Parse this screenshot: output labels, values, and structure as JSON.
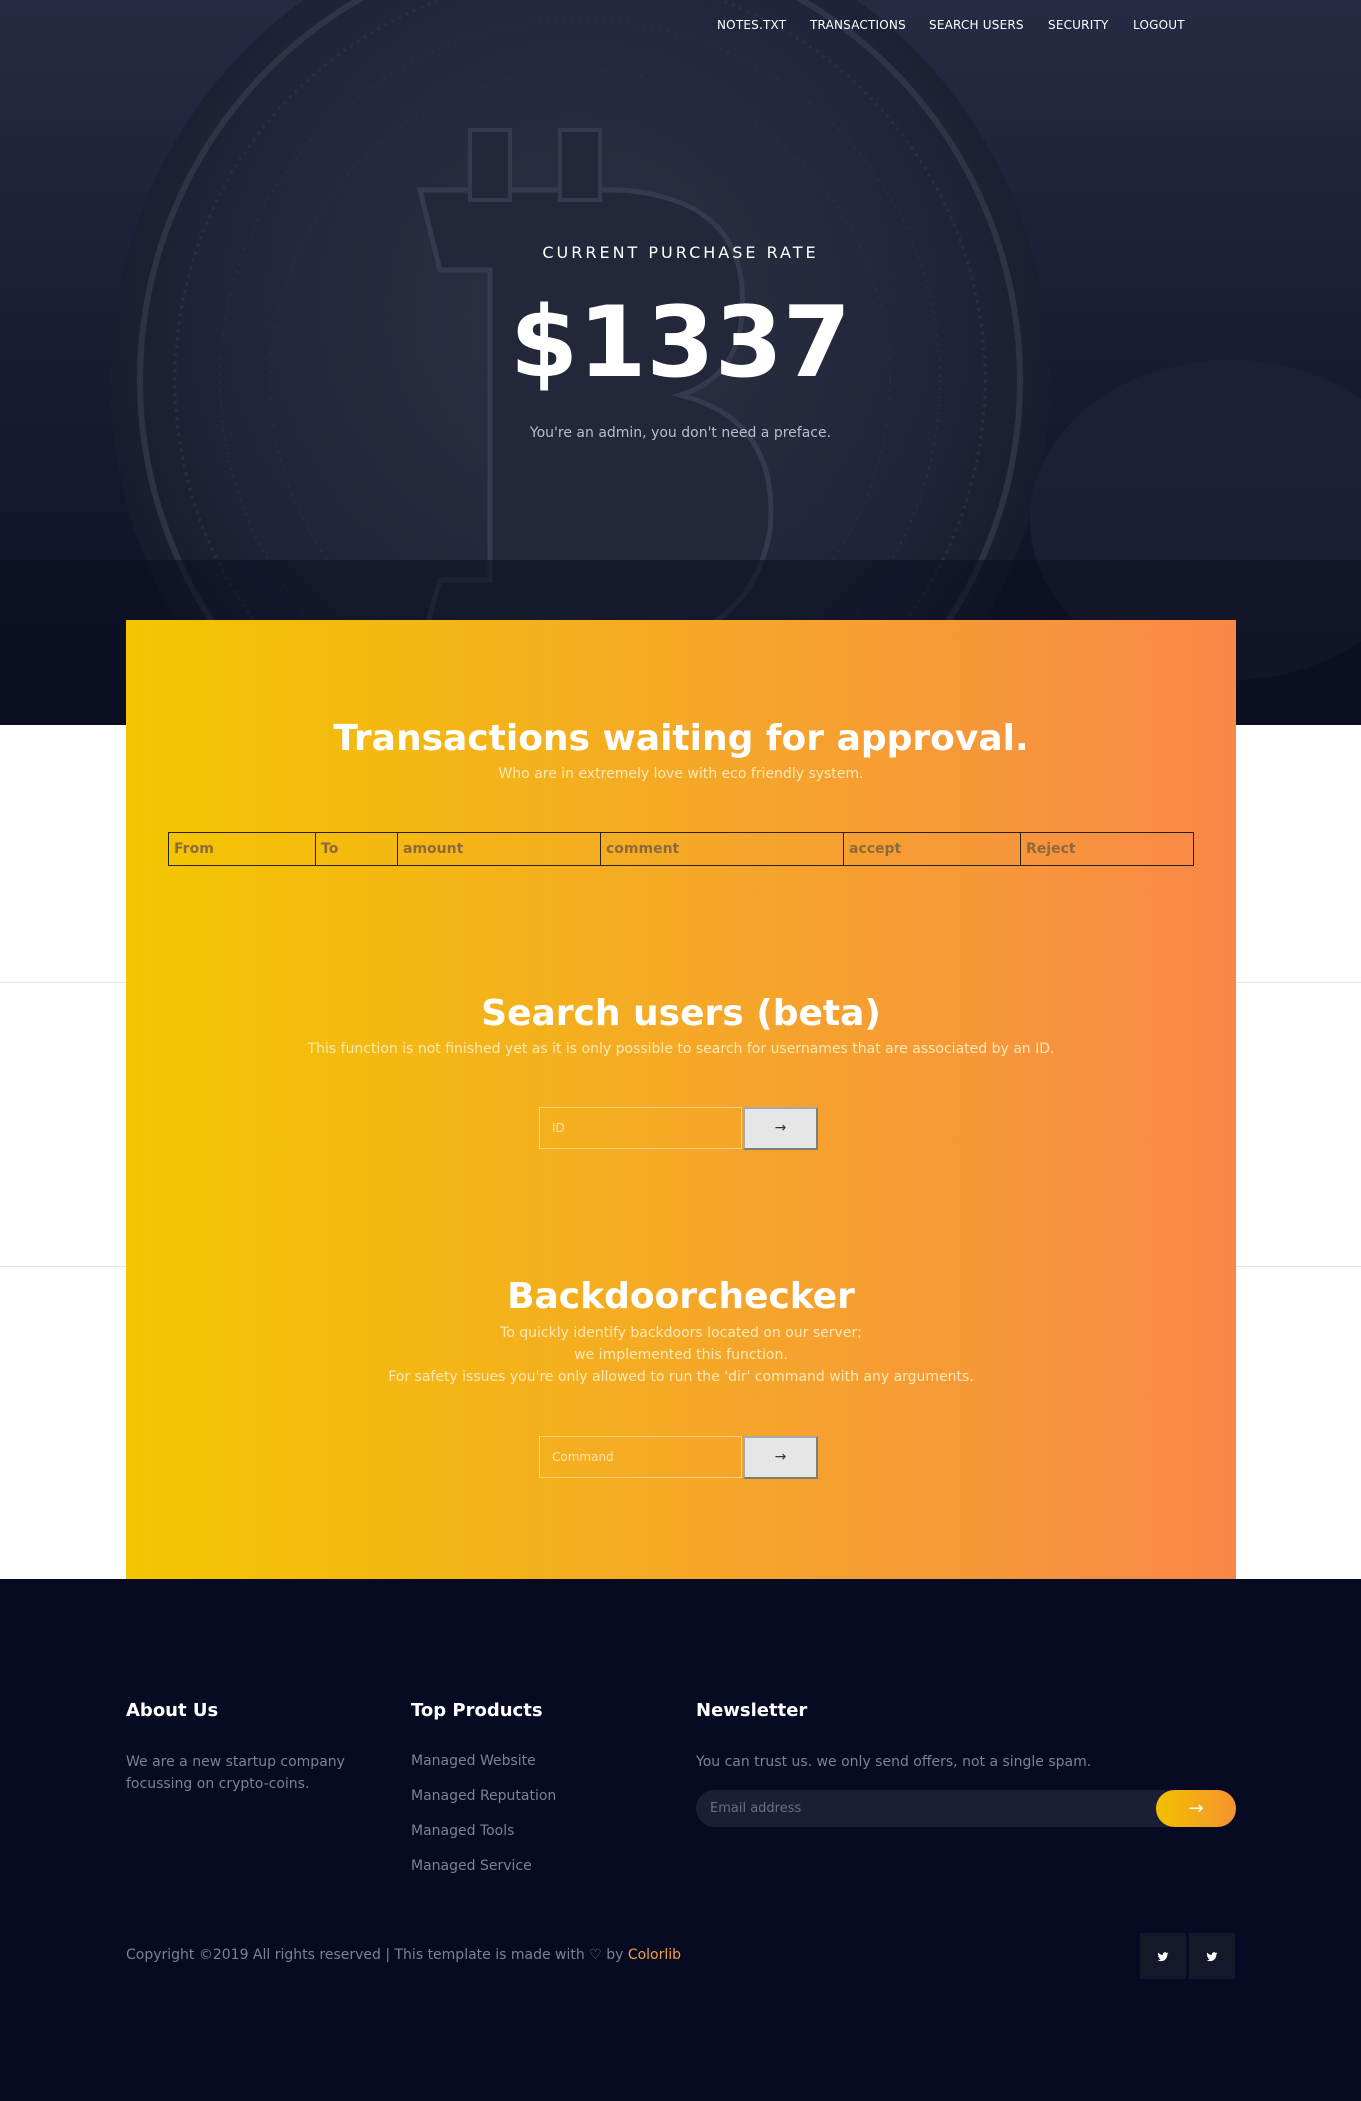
{
  "nav": {
    "items": [
      "NOTES.TXT",
      "TRANSACTIONS",
      "SEARCH USERS",
      "SECURITY",
      "LOGOUT"
    ]
  },
  "hero": {
    "subtitle": "CURRENT PURCHASE RATE",
    "price": "$1337",
    "note": "You're an admin, you don't need a preface."
  },
  "transactions": {
    "title": "Transactions waiting for approval.",
    "subtitle": "Who are in extremely love with eco friendly system.",
    "columns": [
      "From",
      "To",
      "amount",
      "comment",
      "accept",
      "Reject"
    ]
  },
  "search": {
    "title": "Search users (beta)",
    "subtitle": "This function is not finished yet as it is only possible to search for usernames that are associated by an ID.",
    "placeholder": "ID",
    "button": "→"
  },
  "backdoor": {
    "title": "Backdoorchecker",
    "lines": [
      "To quickly identify backdoors located on our server;",
      "we implemented this function.",
      "For safety issues you're only allowed to run the 'dir' command with any arguments."
    ],
    "placeholder": "Command",
    "button": "→"
  },
  "footer": {
    "about": {
      "heading": "About Us",
      "text": "We are a new startup company focussing on crypto-coins."
    },
    "products": {
      "heading": "Top Products",
      "items": [
        "Managed Website",
        "Managed Reputation",
        "Managed Tools",
        "Managed Service"
      ]
    },
    "newsletter": {
      "heading": "Newsletter",
      "text": "You can trust us. we only send offers, not a single spam.",
      "placeholder": "Email address",
      "button": "→"
    },
    "copyright": {
      "prefix": "Copyright ©2019 All rights reserved | This template is made with",
      "heart": "♡",
      "by": "by",
      "brand": "Colorlib"
    },
    "social": [
      "twitter-icon",
      "twitter-icon"
    ]
  },
  "colors": {
    "hero_bg": "#1a1e33",
    "panel_left": "#f3c600",
    "panel_right": "#f88848",
    "footer_bg": "#060a22",
    "brand_accent": "#f4a142"
  }
}
